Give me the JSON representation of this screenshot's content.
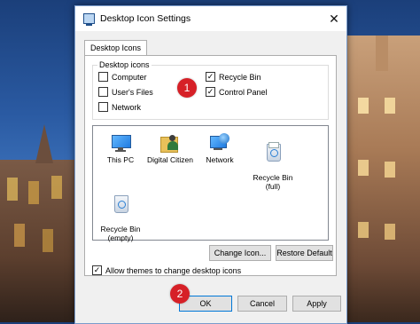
{
  "dialog": {
    "title": "Desktop Icon Settings",
    "close_glyph": "✕",
    "tab_label": "Desktop Icons"
  },
  "desktop_icons_group": {
    "label": "Desktop icons",
    "checkboxes": [
      {
        "label": "Computer",
        "checked": false
      },
      {
        "label": "User's Files",
        "checked": false
      },
      {
        "label": "Network",
        "checked": false
      },
      {
        "label": "Recycle Bin",
        "checked": true
      },
      {
        "label": "Control Panel",
        "checked": true
      }
    ]
  },
  "icon_list": [
    {
      "label": "This PC",
      "icon": "this-pc-icon"
    },
    {
      "label": "Digital Citizen",
      "icon": "user-folder-icon"
    },
    {
      "label": "Network",
      "icon": "network-icon"
    },
    {
      "label": "Recycle Bin\n(full)",
      "icon": "recycle-bin-full-icon"
    },
    {
      "label": "Recycle Bin\n(empty)",
      "icon": "recycle-bin-empty-icon"
    }
  ],
  "buttons": {
    "change_icon": "Change Icon...",
    "restore_default": "Restore Default",
    "ok": "OK",
    "cancel": "Cancel",
    "apply": "Apply"
  },
  "allow_themes": {
    "label": "Allow themes to change desktop icons",
    "checked": true
  },
  "badges": {
    "badge1": "1",
    "badge2": "2"
  },
  "colors": {
    "badge": "#d62027",
    "accent": "#0078d7"
  }
}
